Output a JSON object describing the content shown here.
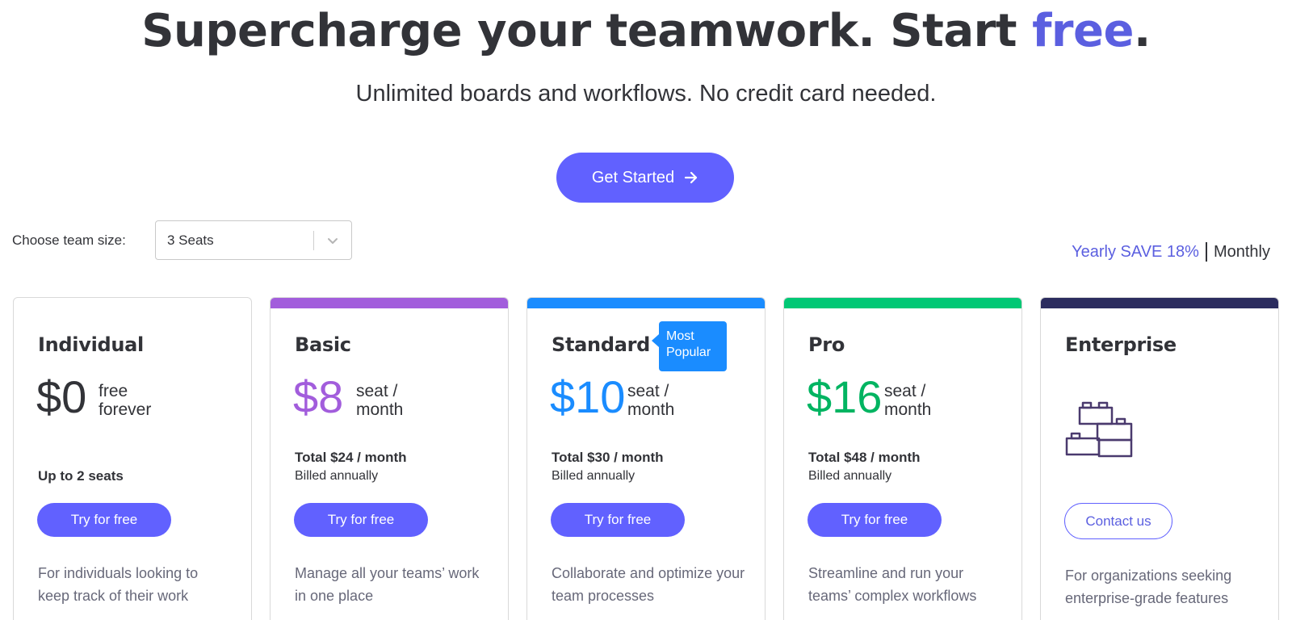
{
  "hero": {
    "headline_main": "Supercharge your teamwork. Start ",
    "headline_accent": "free",
    "headline_end": ".",
    "subheadline": "Unlimited boards and workflows. No credit card needed.",
    "cta_label": "Get Started",
    "cta_icon": "arrow-right-icon"
  },
  "controls": {
    "team_size_label": "Choose team size:",
    "team_size_value": "3 Seats",
    "dropdown_icon": "chevron-down-icon",
    "billing_yearly": "Yearly SAVE 18%",
    "billing_monthly": "Monthly"
  },
  "colors": {
    "accent": "#6161ff",
    "basic": "#a25ddc",
    "standard": "#1a8cff",
    "pro": "#00b461",
    "enterprise": "#2b2c5e"
  },
  "plans": [
    {
      "name": "Individual",
      "price": "$0",
      "unit_line1": "free",
      "unit_line2": "forever",
      "seats": "Up to 2 seats",
      "button": "Try for free",
      "description": "For individuals looking to keep track of their work"
    },
    {
      "name": "Basic",
      "price": "$8",
      "unit_line1": "seat /",
      "unit_line2": "month",
      "total": "Total $24 / month",
      "billed": "Billed annually",
      "button": "Try for free",
      "description": "Manage all your teams’ work in one place"
    },
    {
      "name": "Standard",
      "badge": "Most Popular",
      "price": "$10",
      "unit_line1": "seat /",
      "unit_line2": "month",
      "total": "Total $30 / month",
      "billed": "Billed annually",
      "button": "Try for free",
      "description": "Collaborate and optimize your team processes"
    },
    {
      "name": "Pro",
      "price": "$16",
      "unit_line1": "seat /",
      "unit_line2": "month",
      "total": "Total $48 / month",
      "billed": "Billed annually",
      "button": "Try for free",
      "description": "Streamline and run your teams’ complex workflows"
    },
    {
      "name": "Enterprise",
      "icon": "building-blocks-icon",
      "button": "Contact us",
      "description": "For organizations seeking enterprise-grade features"
    }
  ]
}
